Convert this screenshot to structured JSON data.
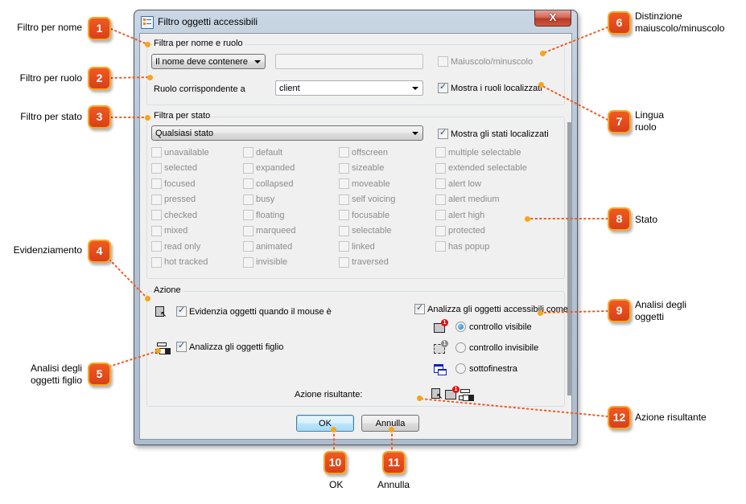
{
  "window": {
    "title": "Filtro oggetti accessibili",
    "close_label": "X"
  },
  "name_role_group": {
    "title": "Filtra per nome e ruolo",
    "name_mode_combo": "Il nome deve contenere",
    "name_input": {
      "value": "",
      "placeholder": ""
    },
    "case_checkbox": {
      "label": "Maiuscolo/minuscolo",
      "checked": false,
      "enabled": false
    },
    "role_label": "Ruolo corrispondente a",
    "role_combo": "client",
    "localized_roles_checkbox": {
      "label": "Mostra i ruoli localizzati",
      "checked": true
    }
  },
  "state_group": {
    "title": "Filtra per stato",
    "state_combo": "Qualsiasi stato",
    "localized_states_checkbox": {
      "label": "Mostra gli stati localizzati",
      "checked": true
    },
    "columns": [
      [
        "unavailable",
        "selected",
        "focused",
        "pressed",
        "checked",
        "mixed",
        "read only",
        "hot tracked"
      ],
      [
        "default",
        "expanded",
        "collapsed",
        "busy",
        "floating",
        "marqueed",
        "animated",
        "invisible"
      ],
      [
        "offscreen",
        "sizeable",
        "moveable",
        "self voicing",
        "focusable",
        "selectable",
        "linked",
        "traversed"
      ],
      [
        "multiple selectable",
        "extended selectable",
        "alert low",
        "alert medium",
        "alert high",
        "protected",
        "has popup"
      ]
    ]
  },
  "action_group": {
    "title": "Azione",
    "highlight_checkbox": {
      "label": "Evidenzia oggetti quando il mouse è",
      "checked": true,
      "icon": "highlight-cursor-icon"
    },
    "children_checkbox": {
      "label": "Analizza gli oggetti figlio",
      "checked": true,
      "icon": "object-tree-icon"
    },
    "analyze_as_checkbox": {
      "label": "Analizza gli oggetti accessibili come",
      "checked": true
    },
    "radios": [
      {
        "label": "controllo visibile",
        "selected": true,
        "icon": "visible-control-icon"
      },
      {
        "label": "controllo invisibile",
        "selected": false,
        "icon": "invisible-control-icon"
      },
      {
        "label": "sottofinestra",
        "selected": false,
        "icon": "subwindow-icon"
      }
    ],
    "result_label": "Azione risultante:"
  },
  "buttons": {
    "ok": "OK",
    "cancel": "Annulla"
  },
  "callouts": [
    {
      "number": "1",
      "label": "Filtro per nome"
    },
    {
      "number": "2",
      "label": "Filtro per ruolo"
    },
    {
      "number": "3",
      "label": "Filtro per stato"
    },
    {
      "number": "4",
      "label": "Evidenziamento"
    },
    {
      "number": "5",
      "label": "Analisi degli oggetti figlio"
    },
    {
      "number": "6",
      "label": "Distinzione maiuscolo/minuscolo"
    },
    {
      "number": "7",
      "label": "Lingua ruolo"
    },
    {
      "number": "8",
      "label": "Stato"
    },
    {
      "number": "9",
      "label": "Analisi degli oggetti"
    },
    {
      "number": "10",
      "label": "OK"
    },
    {
      "number": "11",
      "label": "Annulla"
    },
    {
      "number": "12",
      "label": "Azione risultante"
    }
  ],
  "colors": {
    "badge": "#e04a1c",
    "badge_border": "#f6a623",
    "leader": "#ef5a22",
    "anchor_dot": "#f7a51a"
  }
}
